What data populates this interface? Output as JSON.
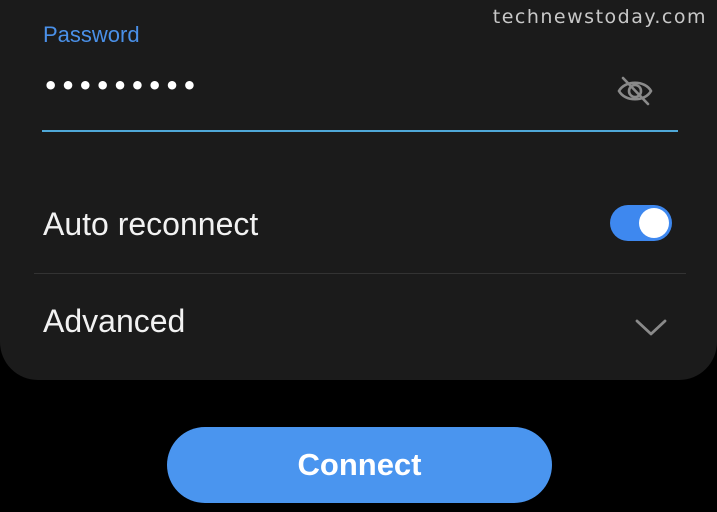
{
  "watermark": "technewstoday.com",
  "password": {
    "label": "Password",
    "value": "•••••••••",
    "visibility_icon": "eye-off-icon"
  },
  "auto_reconnect": {
    "label": "Auto reconnect",
    "enabled": true
  },
  "advanced": {
    "label": "Advanced",
    "expand_icon": "chevron-down-icon"
  },
  "connect": {
    "label": "Connect"
  },
  "colors": {
    "accent": "#4a90e8",
    "toggle_on": "#3e88ef",
    "button": "#4a95ef",
    "card": "#1b1b1b",
    "background": "#000000"
  }
}
